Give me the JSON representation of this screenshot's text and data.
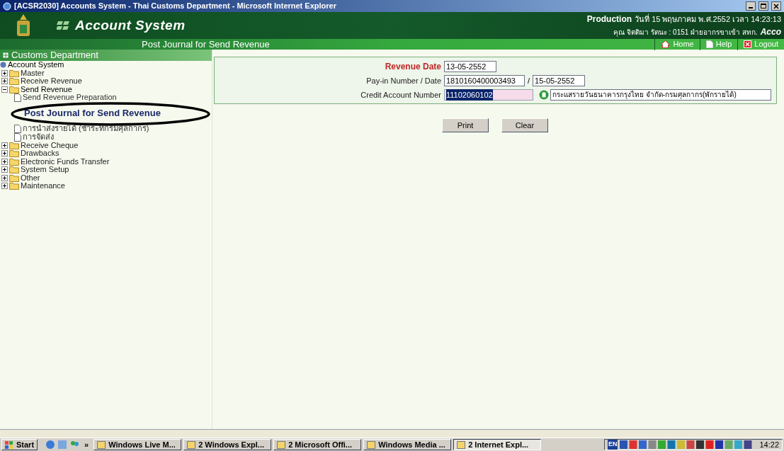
{
  "window": {
    "title": "[ACSR2030] Accounts System - Thai Customs Department - Microsoft Internet Explorer"
  },
  "header": {
    "app_title": "Account System",
    "environment": "Production",
    "datetime": "วันที่ 15 พฤษภาคม พ.ศ.2552 เวลา 14:23:13",
    "user": "คุณ จิตติมา รัตนะ : 0151 ฝ่ายอากรขาเข้า สทก.",
    "logo_text": "Acco"
  },
  "page_title": "Post Journal for Send Revenue",
  "nav_links": [
    {
      "label": "Home",
      "kind": "home"
    },
    {
      "label": "Help",
      "kind": "help"
    },
    {
      "label": "Logout",
      "kind": "logout"
    }
  ],
  "sidebar": {
    "title": "Customs Department",
    "root": "Account System",
    "items": [
      {
        "label": "Master",
        "expanded": false
      },
      {
        "label": "Receive Revenue",
        "expanded": false
      },
      {
        "label": "Send Revenue",
        "expanded": true,
        "children": [
          {
            "label": "Send Revenue Preparation",
            "selected": false
          },
          {
            "label": "Post Journal for Send Revenue",
            "selected": true
          },
          {
            "label": "การนำส่งรายได้ (ชำระที่กรมศุลกากร)",
            "selected": false
          },
          {
            "label": "การจัดส่ง",
            "selected": false
          }
        ]
      },
      {
        "label": "Receive Cheque",
        "expanded": false
      },
      {
        "label": "Drawbacks",
        "expanded": false
      },
      {
        "label": "Electronic Funds Transfer",
        "expanded": false
      },
      {
        "label": "System Setup",
        "expanded": false
      },
      {
        "label": "Other",
        "expanded": false
      },
      {
        "label": "Maintenance",
        "expanded": false
      }
    ]
  },
  "form": {
    "revenue_date": {
      "label": "Revenue Date",
      "value": "13-05-2552"
    },
    "payin": {
      "label": "Pay-in Number / Date",
      "number": "1810160400003493",
      "separator": "/",
      "date": "15-05-2552"
    },
    "credit": {
      "label": "Credit Account Number",
      "value": "11102060102",
      "account_name": "กระแสรายวันธนาคารกรุงไทย จำกัด-กรมศุลกากร(พักรายได้)"
    }
  },
  "buttons": [
    "Print",
    "Clear"
  ],
  "taskbar": {
    "start": "Start",
    "chevron": "»",
    "tasks": [
      {
        "label": "Windows Live M...",
        "selected": false
      },
      {
        "label": "2 Windows Expl...",
        "selected": false
      },
      {
        "label": "2 Microsoft Offi...",
        "selected": false
      },
      {
        "label": "Windows Media ...",
        "selected": false
      },
      {
        "label": "2 Internet Expl...",
        "selected": true
      }
    ],
    "language": "EN",
    "clock": "14:22"
  }
}
